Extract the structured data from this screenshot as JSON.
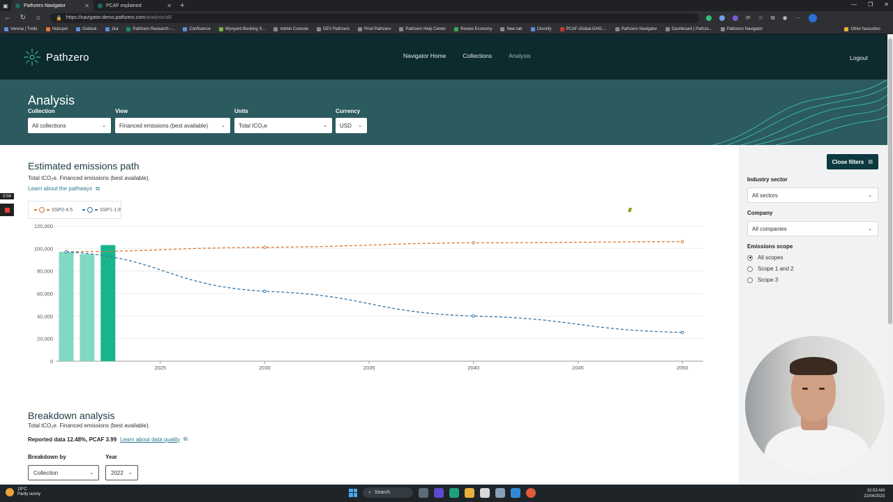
{
  "browser": {
    "tabs": [
      {
        "title": "Pathzero Navigator",
        "active": true
      },
      {
        "title": "PCAF explained",
        "active": false
      }
    ],
    "url_host": "https://navigator.demo.pathzero.com",
    "url_path": "/analysis/all/",
    "bookmarks": [
      "Verena | Trello",
      "Hubspot",
      "Outlook",
      "Jira",
      "Pathzero Research -...",
      "Confluence",
      "Wynyard Booking S...",
      "Admin Console",
      "DEV Pathzero",
      "Prod Pathzero",
      "Pathzero Help Center",
      "Renew Economy",
      "New tab",
      "Clockify",
      "PCAF-Global-GHG-...",
      "Pathzero Navigator",
      "Dashboard | Pathze...",
      "Pathzero Navigator"
    ],
    "other_favourites": "Other favourites"
  },
  "header": {
    "logo": "Pathzero",
    "nav": [
      {
        "label": "Navigator Home",
        "active": false
      },
      {
        "label": "Collections",
        "active": false
      },
      {
        "label": "Analysis",
        "active": true
      }
    ],
    "logout": "Logout"
  },
  "filters": {
    "title": "Analysis",
    "collection": {
      "label": "Collection",
      "value": "All collections"
    },
    "view": {
      "label": "View",
      "value": "Financed emissions (best available)"
    },
    "units": {
      "label": "Units",
      "value": "Total tCO₂e"
    },
    "currency": {
      "label": "Currency",
      "value": "USD"
    }
  },
  "emissions": {
    "title": "Estimated emissions path",
    "subtitle": "Total tCO₂e. Financed emissions (best available).",
    "learn_link": "Learn about the pathways"
  },
  "chart_data": {
    "type": "bar",
    "title": "",
    "xlabel": "",
    "ylabel": "",
    "ylim": [
      0,
      120000
    ],
    "yticks": [
      "0",
      "20,000",
      "40,000",
      "60,000",
      "80,000",
      "100,000",
      "120,000"
    ],
    "xticks": [
      "2025",
      "2030",
      "2035",
      "2040",
      "2045",
      "2050"
    ],
    "xlim": [
      2020,
      2051
    ],
    "bars": [
      {
        "x": 2020.5,
        "value": 97000,
        "color": "#7fd9c4"
      },
      {
        "x": 2021.5,
        "value": 95000,
        "color": "#7fd9c4"
      },
      {
        "x": 2022.5,
        "value": 103000,
        "color": "#18b58c"
      }
    ],
    "series": [
      {
        "name": "SSP2-4.5",
        "style": "dashed",
        "color": "#d9722b",
        "x": [
          2020.5,
          2030,
          2040,
          2050
        ],
        "y": [
          97000,
          101000,
          105000,
          106000
        ]
      },
      {
        "name": "SSP1-1.9",
        "style": "dashed",
        "color": "#2f73a6",
        "x": [
          2020.5,
          2030,
          2040,
          2050
        ],
        "y": [
          97000,
          62000,
          40000,
          25500
        ]
      }
    ],
    "grid": true,
    "legend": "top-left"
  },
  "breakdown": {
    "title": "Breakdown analysis",
    "subtitle": "Total tCO₂e. Financed emissions (best available).",
    "quality_text": "Reported data 12.48%, PCAF 3.99",
    "quality_link": "Learn about data quality",
    "by_label": "Breakdown by",
    "by_value": "Collection",
    "year_label": "Year",
    "year_value": "2022"
  },
  "side": {
    "close_filters": "Close filters",
    "industry": {
      "label": "Industry sector",
      "value": "All sectors"
    },
    "company": {
      "label": "Company",
      "value": "All companies"
    },
    "scope": {
      "label": "Emissions scope",
      "options": [
        {
          "label": "All scopes",
          "selected": true
        },
        {
          "label": "Scope 1 and 2",
          "selected": false
        },
        {
          "label": "Scope 3",
          "selected": false
        }
      ]
    }
  },
  "recording": {
    "time": "0:04"
  },
  "taskbar": {
    "temp": "19°C",
    "weather": "Partly sunny",
    "search": "Search",
    "time": "10:53 AM",
    "date": "21/04/2023"
  }
}
